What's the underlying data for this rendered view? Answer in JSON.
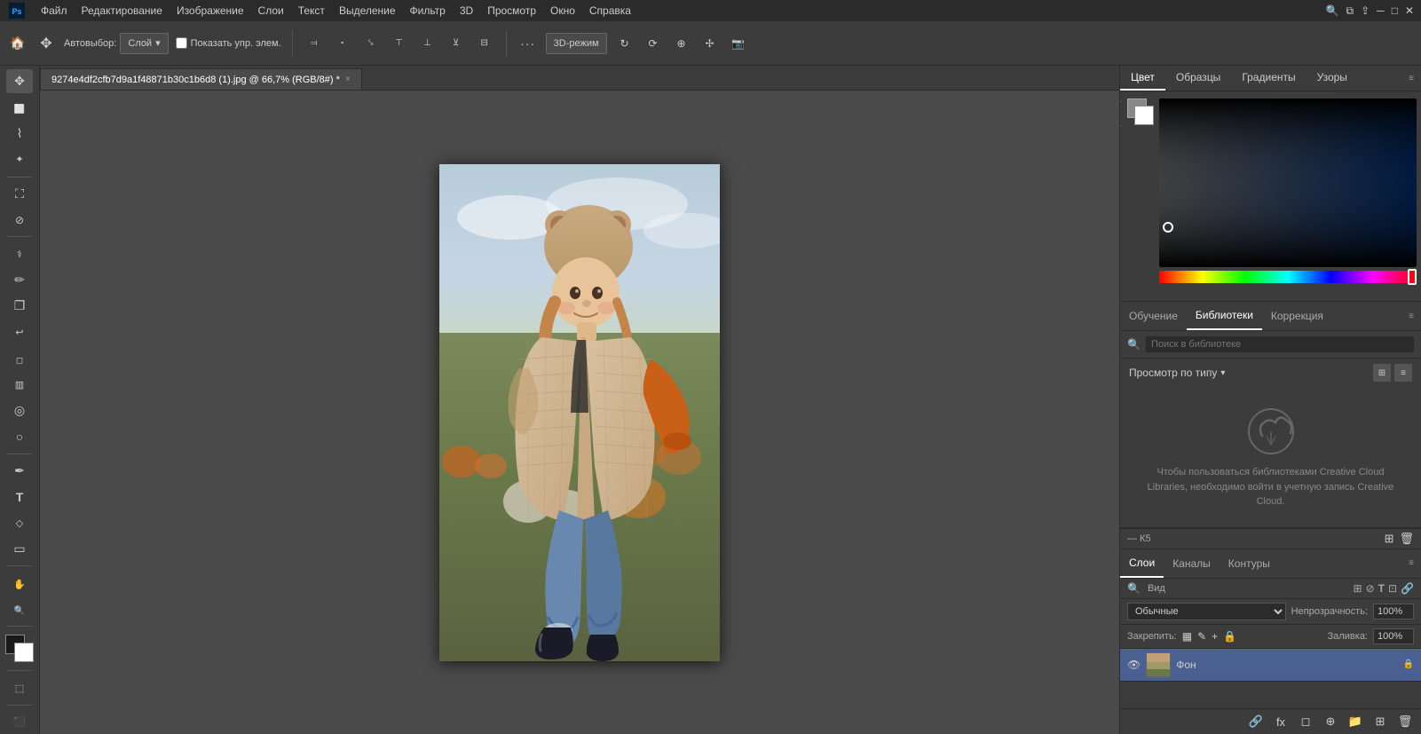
{
  "app": {
    "title": "Adobe Photoshop"
  },
  "menubar": {
    "items": [
      "Файл",
      "Редактирование",
      "Изображение",
      "Слои",
      "Текст",
      "Выделение",
      "Фильтр",
      "3D",
      "Просмотр",
      "Окно",
      "Справка"
    ]
  },
  "toolbar": {
    "autoselect_label": "Автовыбор:",
    "layer_label": "Слой",
    "show_transform_label": "Показать упр. элем.",
    "more_label": "···",
    "3d_label": "3D-режим"
  },
  "tab": {
    "filename": "9274e4df2cfb7d9a1f48871b30c1b6d8 (1).jpg @ 66,7% (RGB/8#) *",
    "close_label": "×"
  },
  "color_panel": {
    "tabs": [
      "Цвет",
      "Образцы",
      "Градиенты",
      "Узоры"
    ],
    "active_tab": "Цвет"
  },
  "libraries_panel": {
    "tabs": [
      "Обучение",
      "Библиотеки",
      "Коррекция"
    ],
    "active_tab": "Библиотеки",
    "search_placeholder": "Поиск в библиотеке",
    "view_by_type_label": "Просмотр по типу",
    "empty_message": "Чтобы пользоваться библиотеками\nCreative Cloud Libraries, необходимо\nвойти в учетную запись Creative Cloud."
  },
  "layers_panel": {
    "tabs": [
      "Слои",
      "Каналы",
      "Контуры"
    ],
    "active_tab": "Слои",
    "mode_label": "Обычные",
    "opacity_label": "Непрозрачность:",
    "opacity_value": "100%",
    "lock_label": "Закрепить:",
    "fill_label": "Заливка:",
    "fill_value": "100%",
    "layers_tool_icons": [
      "search",
      "filter"
    ],
    "kb_label": "— К5",
    "layers": [
      {
        "name": "Фон",
        "visible": true,
        "locked": true,
        "thumb_bg": "#c4a882"
      }
    ]
  }
}
